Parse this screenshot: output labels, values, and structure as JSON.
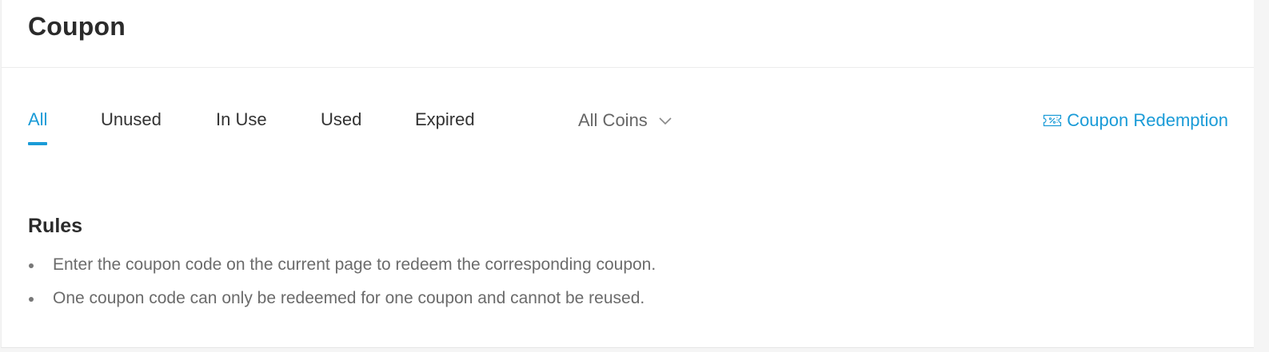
{
  "header": {
    "title": "Coupon"
  },
  "tabs": [
    {
      "label": "All",
      "active": true
    },
    {
      "label": "Unused",
      "active": false
    },
    {
      "label": "In Use",
      "active": false
    },
    {
      "label": "Used",
      "active": false
    },
    {
      "label": "Expired",
      "active": false
    }
  ],
  "filter": {
    "selected": "All Coins",
    "icon": "chevron-down-icon"
  },
  "redemption": {
    "label": "Coupon Redemption",
    "icon": "coupon-ticket-icon"
  },
  "rules": {
    "title": "Rules",
    "items": [
      "Enter the coupon code on the current page to redeem the corresponding coupon.",
      "One coupon code can only be redeemed for one coupon and cannot be reused."
    ]
  },
  "colors": {
    "accent": "#1a9bd7",
    "text_primary": "#2b2b2b",
    "text_secondary": "#6b6b6b"
  }
}
